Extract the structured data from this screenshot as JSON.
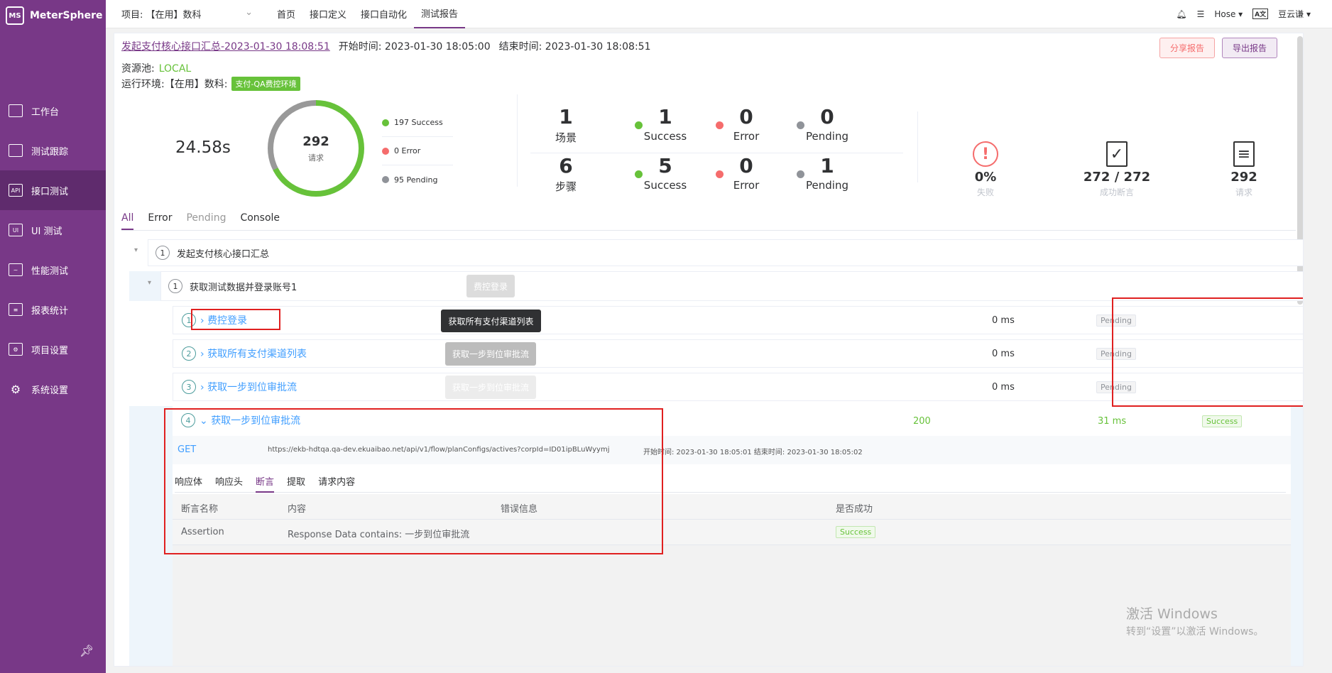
{
  "app": {
    "name": "MeterSphere",
    "logo_text": "MS"
  },
  "sidebar": {
    "items": [
      {
        "label": "工作台",
        "icon": "monitor-icon"
      },
      {
        "label": "测试跟踪",
        "icon": "clipboard-icon"
      },
      {
        "label": "接口测试",
        "icon": "api-icon",
        "active": true
      },
      {
        "label": "UI 测试",
        "icon": "ui-icon"
      },
      {
        "label": "性能测试",
        "icon": "chart-icon"
      },
      {
        "label": "报表统计",
        "icon": "report-icon"
      },
      {
        "label": "项目设置",
        "icon": "folder-gear-icon"
      },
      {
        "label": "系统设置",
        "icon": "gears-icon"
      }
    ]
  },
  "topbar": {
    "project_label": "项目: 【在用】数科",
    "menu": [
      "首页",
      "接口定义",
      "接口自动化",
      "测试报告"
    ],
    "active_menu": 3,
    "user": "Hose",
    "org": "豆云谦"
  },
  "report": {
    "name": "发起支付核心接口汇总-2023-01-30 18:08:51",
    "start_label": "开始时间:",
    "start_time": "2023-01-30 18:05:00",
    "end_label": "结束时间:",
    "end_time": "2023-01-30 18:08:51",
    "share_button": "分享报告",
    "export_button": "导出报告",
    "pool_label": "资源池:",
    "pool_value": "LOCAL",
    "env_label": "运行环境:【在用】数科:",
    "env_tag": "支付-QA费控环境"
  },
  "summary": {
    "duration": "24.58s",
    "total": "292",
    "total_label": "请求",
    "success_fraction": 0.675,
    "legend": [
      {
        "label": "197 Success",
        "color": "#67c23a"
      },
      {
        "label": "0 Error",
        "color": "#f56c6c"
      },
      {
        "label": "95 Pending",
        "color": "#909399"
      }
    ],
    "scenario": {
      "count": "1",
      "label": "场景",
      "success": "1",
      "error": "0",
      "pending": "0"
    },
    "step": {
      "count": "6",
      "label": "步骤",
      "success": "5",
      "error": "0",
      "pending": "1"
    },
    "success_label": "Success",
    "error_label": "Error",
    "pending_label": "Pending",
    "kpis": [
      {
        "value": "0%",
        "label": "失败",
        "icon": "alert-circle-icon"
      },
      {
        "value": "272 / 272",
        "label": "成功断言",
        "icon": "file-check-icon"
      },
      {
        "value": "292",
        "label": "请求",
        "icon": "copy-icon"
      }
    ]
  },
  "tabs": [
    "All",
    "Error",
    "Pending",
    "Console"
  ],
  "tree": {
    "root": {
      "index": "1",
      "name": "发起支付核心接口汇总"
    },
    "child": {
      "index": "1",
      "name": "获取测试数据并登录账号1",
      "tag": "费控登录"
    },
    "steps": [
      {
        "index": "1",
        "name": "费控登录",
        "time": "0 ms",
        "status": "Pending"
      },
      {
        "index": "2",
        "name": "获取所有支付渠道列表",
        "time": "0 ms",
        "status": "Pending"
      },
      {
        "index": "3",
        "name": "获取一步到位审批流",
        "time": "0 ms",
        "status": "Pending"
      },
      {
        "index": "4",
        "name": "获取一步到位审批流",
        "code": "200",
        "time": "31 ms",
        "status": "Success"
      }
    ],
    "tooltip": "获取所有支付渠道列表",
    "float_btn_1": "获取一步到位审批流",
    "float_btn_2": "获取一步到位审批流"
  },
  "detail": {
    "method": "GET",
    "url": "https://ekb-hdtqa.qa-dev.ekuaibao.net/api/v1/flow/planConfigs/actives?corpId=ID01ipBLuWyymj",
    "timing": "开始时间: 2023-01-30 18:05:01 结束时间: 2023-01-30 18:05:02",
    "tabs": [
      "响应体",
      "响应头",
      "断言",
      "提取",
      "请求内容"
    ],
    "active_tab": 2,
    "columns": [
      "断言名称",
      "内容",
      "错误信息",
      "是否成功"
    ],
    "rows": [
      {
        "name": "Assertion",
        "content": "Response Data contains: 一步到位审批流",
        "error": "",
        "result": "Success"
      }
    ]
  },
  "watermark": {
    "line1": "激活 Windows",
    "line2": "转到“设置”以激活 Windows。"
  }
}
